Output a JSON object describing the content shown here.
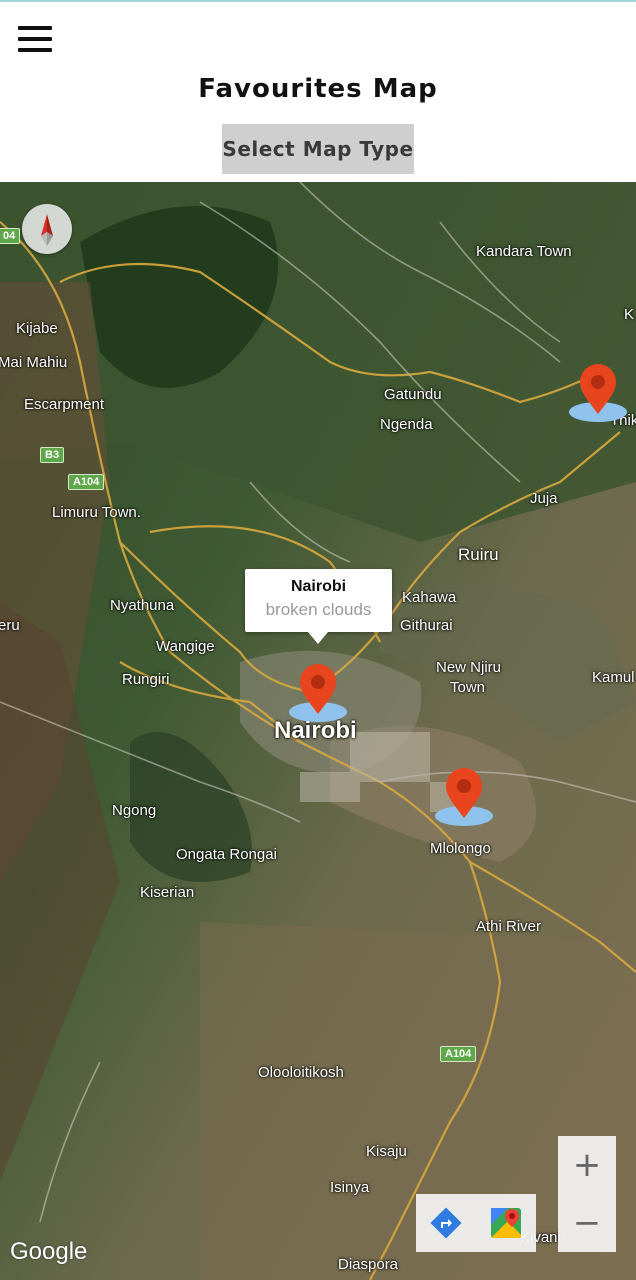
{
  "header": {
    "title": "Favourites Map",
    "map_type_button": "Select Map Type"
  },
  "map": {
    "type": "satellite",
    "labels": {
      "kandara": "Kandara Town",
      "kijabe": "Kijabe",
      "maimahiu": "Mai Mahiu",
      "escarpment": "Escarpment",
      "gatundu": "Gatundu",
      "ngenda": "Ngenda",
      "juja": "Juja",
      "limuru": "Limuru Town.",
      "ruiru": "Ruiru",
      "kahawa": "Kahawa",
      "githurai": "Githurai",
      "nyathuna": "Nyathuna",
      "eru": "eru",
      "wangige": "Wangige",
      "newnjiru": "New Njiru",
      "town": "Town",
      "kamulu": "Kamul",
      "rungiri": "Rungiri",
      "nairobi": "Nairobi",
      "ngong": "Ngong",
      "mlolongo": "Mlolongo",
      "ongata": "Ongata Rongai",
      "kiserian": "Kiserian",
      "athiriver": "Athi River",
      "oloolo": "Olooloitikosh",
      "kisaju": "Kisaju",
      "isinya": "Isinya",
      "diaspora": "Diaspora",
      "kivani": "Kivani",
      "thika": "Thik",
      "k": "K"
    },
    "shields": {
      "b3": "B3",
      "a104a": "A104",
      "a104b": "A104",
      "top": "04"
    },
    "info_window": {
      "city": "Nairobi",
      "weather": "broken clouds"
    },
    "zoom_in": "+",
    "zoom_out": "−",
    "attribution": "Google",
    "colors": {
      "marker": "#e8451e",
      "marker_base": "#8fc3ee"
    }
  }
}
